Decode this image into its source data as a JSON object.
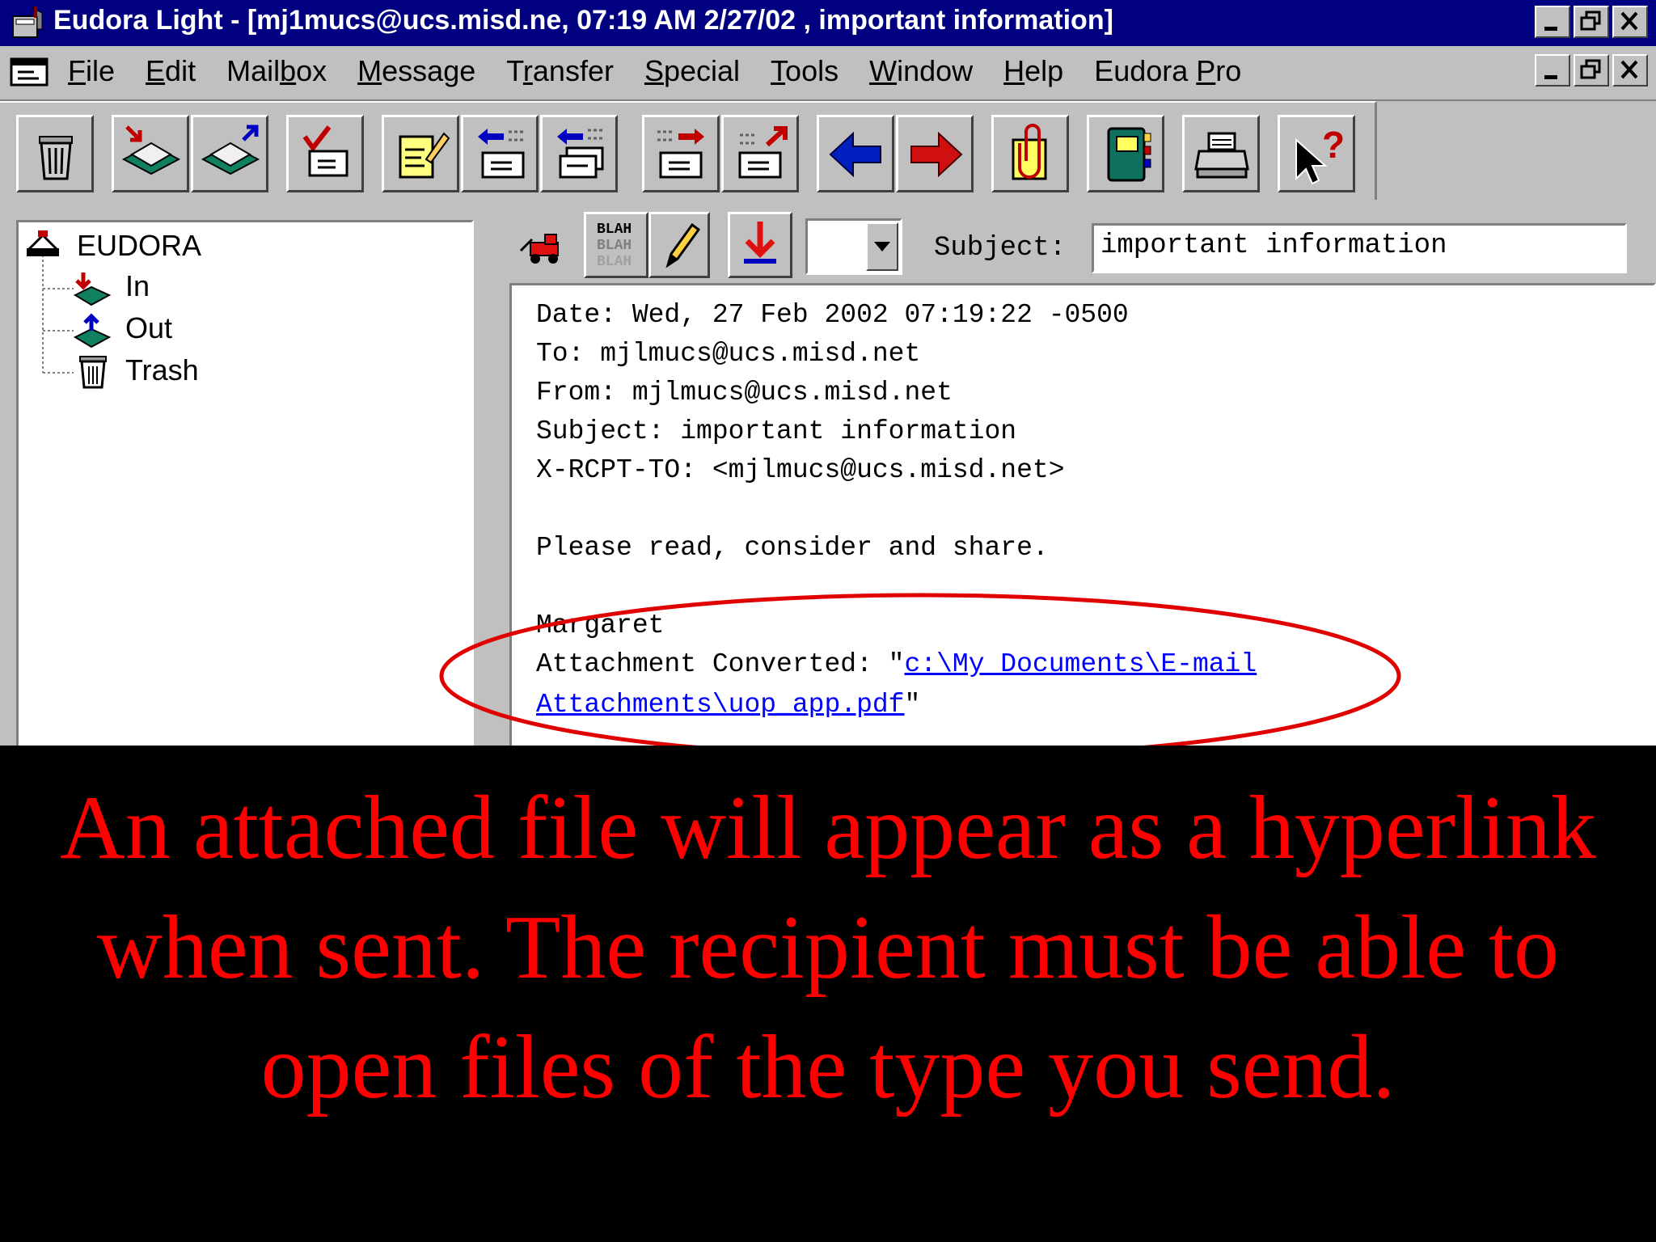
{
  "window": {
    "title": "Eudora Light - [mj1mucs@ucs.misd.ne, 07:19 AM 2/27/02 , important information]"
  },
  "menu": [
    {
      "key": "F",
      "rest": "ile"
    },
    {
      "key": "E",
      "rest": "dit"
    },
    {
      "pre": "Mail",
      "key": "b",
      "rest": "ox"
    },
    {
      "key": "M",
      "rest": "essage"
    },
    {
      "pre": "T",
      "key": "r",
      "rest": "ansfer"
    },
    {
      "key": "S",
      "rest": "pecial"
    },
    {
      "key": "T",
      "rest": "ools"
    },
    {
      "key": "W",
      "rest": "indow"
    },
    {
      "key": "H",
      "rest": "elp"
    },
    {
      "pre": "Eudora ",
      "key": "P",
      "rest": "ro"
    }
  ],
  "tree": {
    "root": "EUDORA",
    "items": [
      "In",
      "Out",
      "Trash"
    ]
  },
  "message": {
    "subject_label": "Subject:",
    "subject_value": "important information",
    "priority_value": "",
    "lines": [
      "Date: Wed, 27 Feb 2002 07:19:22 -0500",
      "To: mjlmucs@ucs.misd.net",
      "From: mjlmucs@ucs.misd.net",
      "Subject: important information",
      "X-RCPT-TO: <mjlmucs@ucs.misd.net>",
      "Please read, consider and share.",
      "Margaret"
    ],
    "attachment_prefix": "Attachment Converted: \"",
    "attachment_link_1": "c:\\My Documents\\E-mail",
    "attachment_link_2": "Attachments\\uop_app.pdf",
    "attachment_suffix": "\""
  },
  "caption": "An attached file will appear as a hyperlink when sent. The recipient must be able to open files of the type you send.",
  "colors": {
    "titlebar": "#000080",
    "annotation_ellipse": "#e00000",
    "caption": "#ff0000",
    "link": "#0000ff"
  }
}
